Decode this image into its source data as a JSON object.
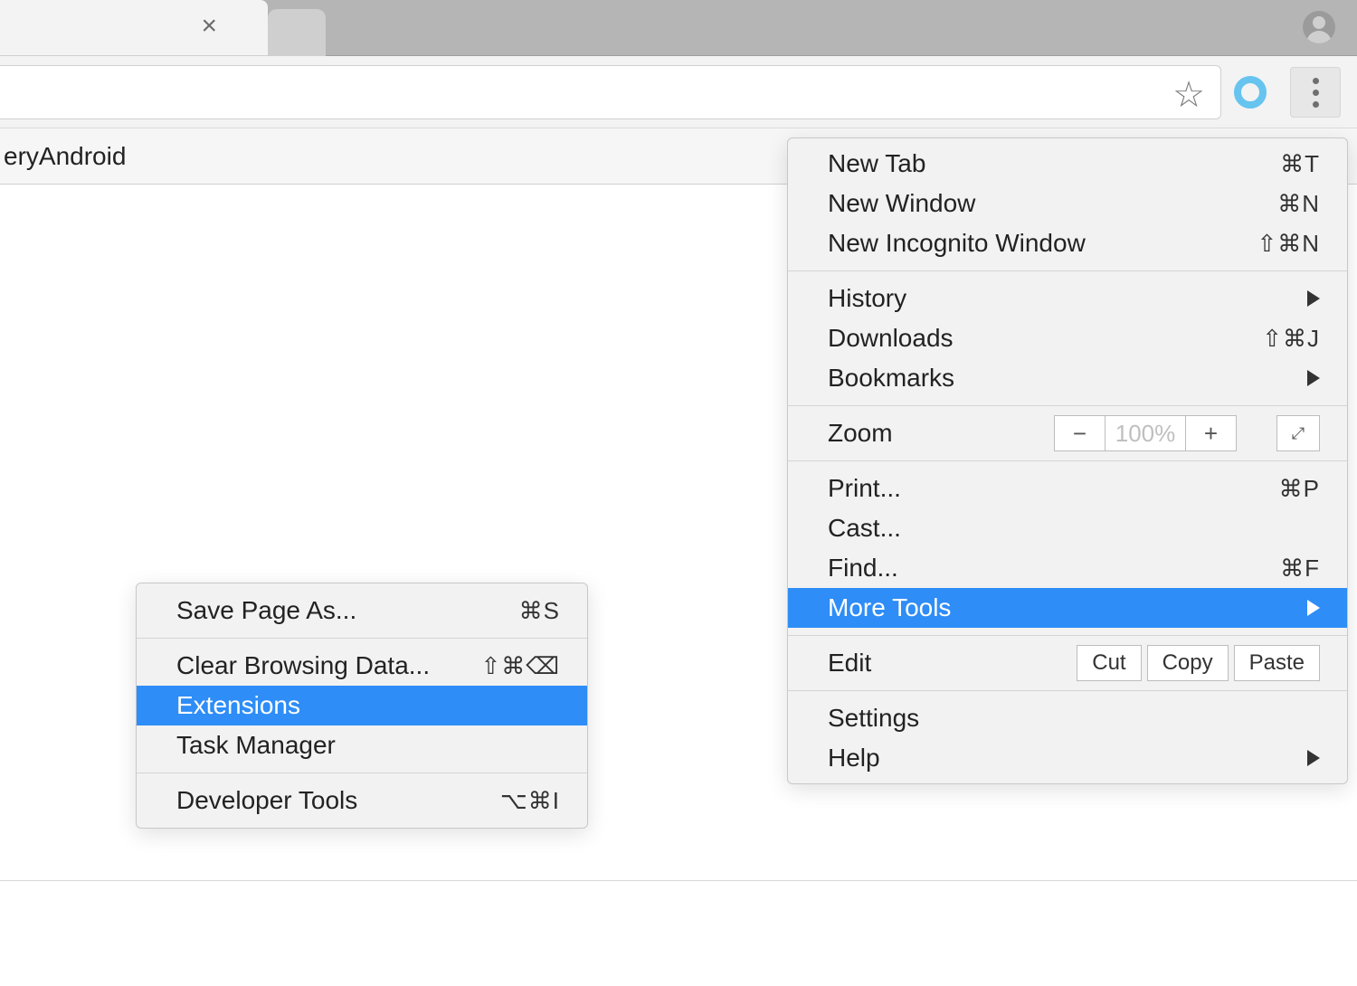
{
  "page": {
    "strip_text": "eryAndroid"
  },
  "menu": {
    "new_tab": {
      "label": "New Tab",
      "shortcut": "⌘T"
    },
    "new_window": {
      "label": "New Window",
      "shortcut": "⌘N"
    },
    "new_incog": {
      "label": "New Incognito Window",
      "shortcut": "⇧⌘N"
    },
    "history": {
      "label": "History"
    },
    "downloads": {
      "label": "Downloads",
      "shortcut": "⇧⌘J"
    },
    "bookmarks": {
      "label": "Bookmarks"
    },
    "zoom": {
      "label": "Zoom",
      "value": "100%"
    },
    "print": {
      "label": "Print...",
      "shortcut": "⌘P"
    },
    "cast": {
      "label": "Cast..."
    },
    "find": {
      "label": "Find...",
      "shortcut": "⌘F"
    },
    "more_tools": {
      "label": "More Tools"
    },
    "edit": {
      "label": "Edit",
      "cut": "Cut",
      "copy": "Copy",
      "paste": "Paste"
    },
    "settings": {
      "label": "Settings"
    },
    "help": {
      "label": "Help"
    }
  },
  "submenu": {
    "save_page": {
      "label": "Save Page As...",
      "shortcut": "⌘S"
    },
    "clear_data": {
      "label": "Clear Browsing Data...",
      "shortcut": "⇧⌘⌫"
    },
    "extensions": {
      "label": "Extensions"
    },
    "task_manager": {
      "label": "Task Manager"
    },
    "dev_tools": {
      "label": "Developer Tools",
      "shortcut": "⌥⌘I"
    }
  }
}
